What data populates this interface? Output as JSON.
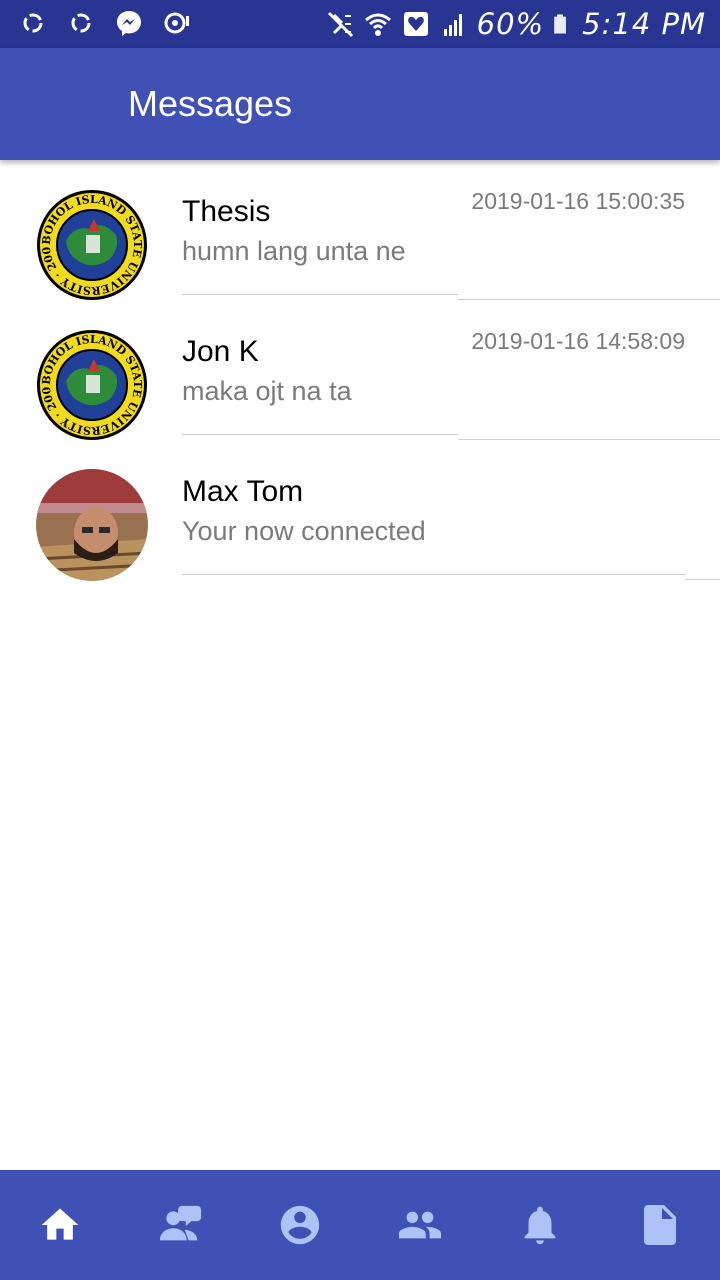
{
  "status_bar": {
    "battery": "60%",
    "time": "5:14 PM"
  },
  "header": {
    "title": "Messages"
  },
  "conversations": [
    {
      "name": "Thesis",
      "preview": "humn lang unta ne",
      "time": "2019-01-16 15:00:35",
      "avatar": "university-seal"
    },
    {
      "name": "Jon K",
      "preview": "maka ojt na ta",
      "time": "2019-01-16 14:58:09",
      "avatar": "university-seal"
    },
    {
      "name": "Max Tom",
      "preview": "Your now connected",
      "time": "",
      "avatar": "user-photo"
    }
  ],
  "seal_text": "BOHOL ISLAND STATE UNIVERSITY · 2009 ·",
  "bottom_nav": [
    {
      "icon": "home-icon",
      "active": true
    },
    {
      "icon": "people-chat-icon",
      "active": false
    },
    {
      "icon": "account-circle-icon",
      "active": false
    },
    {
      "icon": "group-icon",
      "active": false
    },
    {
      "icon": "bell-icon",
      "active": false
    },
    {
      "icon": "document-icon",
      "active": false
    }
  ],
  "colors": {
    "status_bar": "#283593",
    "primary": "#3F51B5",
    "nav_active": "#ffffff",
    "nav_inactive": "#AEC2F7",
    "secondary_text": "#7b7b7b"
  }
}
